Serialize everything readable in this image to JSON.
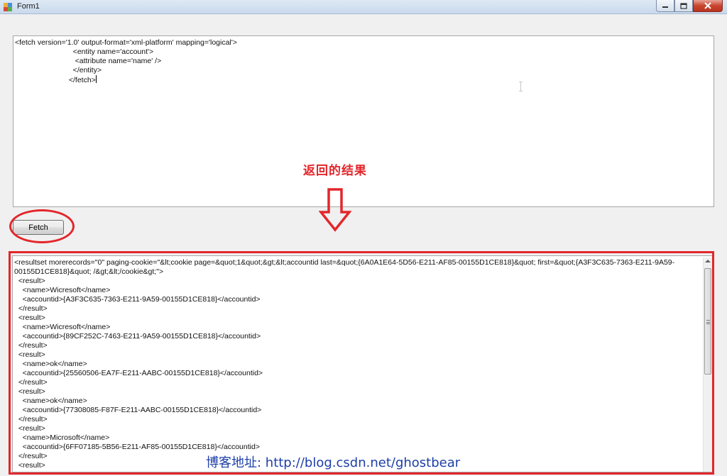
{
  "window": {
    "title": "Form1"
  },
  "query": {
    "lines": [
      "<fetch version='1.0' output-format='xml-platform' mapping='logical'>",
      "                            <entity name='account'>",
      "                             <attribute name='name' />",
      "                            </entity>",
      "                          </fetch>"
    ]
  },
  "annotation": {
    "label": "返回的结果",
    "color": "#e3262b"
  },
  "fetch_button": {
    "label": "Fetch"
  },
  "result": {
    "lines": [
      "<resultset morerecords=\"0\" paging-cookie=\"&lt;cookie page=&quot;1&quot;&gt;&lt;accountid last=&quot;{6A0A1E64-5D56-E211-AF85-00155D1CE818}&quot; first=&quot;{A3F3C635-7363-E211-9A59-",
      "00155D1CE818}&quot; /&gt;&lt;/cookie&gt;\">",
      "  <result>",
      "    <name>Wicresoft</name>",
      "    <accountid>{A3F3C635-7363-E211-9A59-00155D1CE818}</accountid>",
      "  </result>",
      "  <result>",
      "    <name>Wicresoft</name>",
      "    <accountid>{89CF252C-7463-E211-9A59-00155D1CE818}</accountid>",
      "  </result>",
      "  <result>",
      "    <name>ok</name>",
      "    <accountid>{25560506-EA7F-E211-AABC-00155D1CE818}</accountid>",
      "  </result>",
      "  <result>",
      "    <name>ok</name>",
      "    <accountid>{77308085-F87F-E211-AABC-00155D1CE818}</accountid>",
      "  </result>",
      "  <result>",
      "    <name>Microsoft</name>",
      "    <accountid>{6FF07185-5B56-E211-AF85-00155D1CE818}</accountid>",
      "  </result>",
      "  <result>"
    ]
  },
  "watermark": {
    "text": "博客地址: http://blog.csdn.net/ghostbear"
  },
  "colors": {
    "annotation_red": "#e3262b",
    "watermark_blue": "#1e3fa8"
  }
}
